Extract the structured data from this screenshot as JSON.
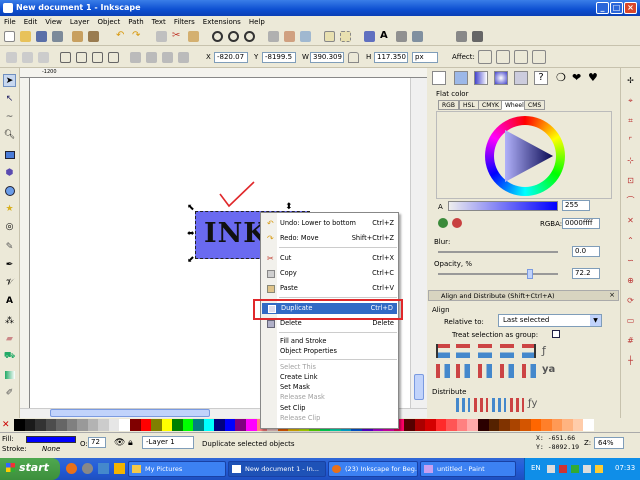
{
  "window": {
    "title": "New document 1 - Inkscape"
  },
  "menubar": [
    "File",
    "Edit",
    "View",
    "Layer",
    "Object",
    "Path",
    "Text",
    "Filters",
    "Extensions",
    "Help"
  ],
  "toolbar": {
    "x_label": "X",
    "x_value": "-820.07",
    "y_label": "Y",
    "y_value": "-8199.5",
    "w_label": "W",
    "w_value": "390.309",
    "h_label": "H",
    "h_value": "117.350",
    "unit": "px",
    "affect_label": "Affect:"
  },
  "canvas": {
    "text_object": "INKS"
  },
  "ruler": {
    "tick_label": "-1200"
  },
  "context_menu": {
    "items": [
      {
        "label": "Undo: Lower to bottom",
        "shortcut": "Ctrl+Z",
        "disabled": false
      },
      {
        "label": "Redo: Move",
        "shortcut": "Shift+Ctrl+Z",
        "disabled": false
      },
      {
        "label": "Cut",
        "shortcut": "Ctrl+X",
        "disabled": false
      },
      {
        "label": "Copy",
        "shortcut": "Ctrl+C",
        "disabled": false
      },
      {
        "label": "Paste",
        "shortcut": "Ctrl+V",
        "disabled": false
      },
      {
        "label": "Duplicate",
        "shortcut": "Ctrl+D",
        "disabled": false,
        "highlighted": true
      },
      {
        "label": "Delete",
        "shortcut": "Delete",
        "disabled": false
      },
      {
        "label": "Fill and Stroke",
        "shortcut": "",
        "disabled": false
      },
      {
        "label": "Object Properties",
        "shortcut": "",
        "disabled": false
      },
      {
        "label": "Select This",
        "shortcut": "",
        "disabled": true
      },
      {
        "label": "Create Link",
        "shortcut": "",
        "disabled": false
      },
      {
        "label": "Set Mask",
        "shortcut": "",
        "disabled": false
      },
      {
        "label": "Release Mask",
        "shortcut": "",
        "disabled": true
      },
      {
        "label": "Set Clip",
        "shortcut": "",
        "disabled": false
      },
      {
        "label": "Release Clip",
        "shortcut": "",
        "disabled": true
      }
    ]
  },
  "fill_panel": {
    "flat_color_label": "Flat color",
    "tabs": [
      "RGB",
      "HSL",
      "CMYK",
      "Wheel",
      "CMS"
    ],
    "active_tab": "Wheel",
    "alpha_label": "A",
    "alpha_value": "255",
    "rgba_label": "RGBA:",
    "rgba_value": "0000ffff",
    "blur_label": "Blur:",
    "blur_value": "0.0",
    "opacity_label": "Opacity, %",
    "opacity_value": "72.2"
  },
  "align_panel": {
    "header": "Align and Distribute (Shift+Ctrl+A)",
    "align_label": "Align",
    "relative_to_label": "Relative to:",
    "relative_to_value": "Last selected",
    "treat_group_label": "Treat selection as group:",
    "distribute_label": "Distribute"
  },
  "statusbar": {
    "fill_label": "Fill:",
    "stroke_label": "Stroke:",
    "stroke_value": "None",
    "o_label": "O:",
    "o_value": "72",
    "layer_value": "-Layer 1",
    "message": "Duplicate selected objects",
    "x_coord": "X: -651.66",
    "y_coord": "Y: -8092.19",
    "z_label": "Z:",
    "zoom": "64%"
  },
  "taskbar": {
    "start": "start",
    "tasks": [
      "My Pictures",
      "New document 1 - In...",
      "(23) Inkscape for Beg...",
      "untitled - Paint"
    ],
    "language": "EN",
    "clock": "07:33"
  },
  "colors": {
    "fill_blue": "#0000ff",
    "selection_blue": "#316ac5",
    "highlight_red": "#e0282b",
    "xp_blue": "#245edb"
  }
}
